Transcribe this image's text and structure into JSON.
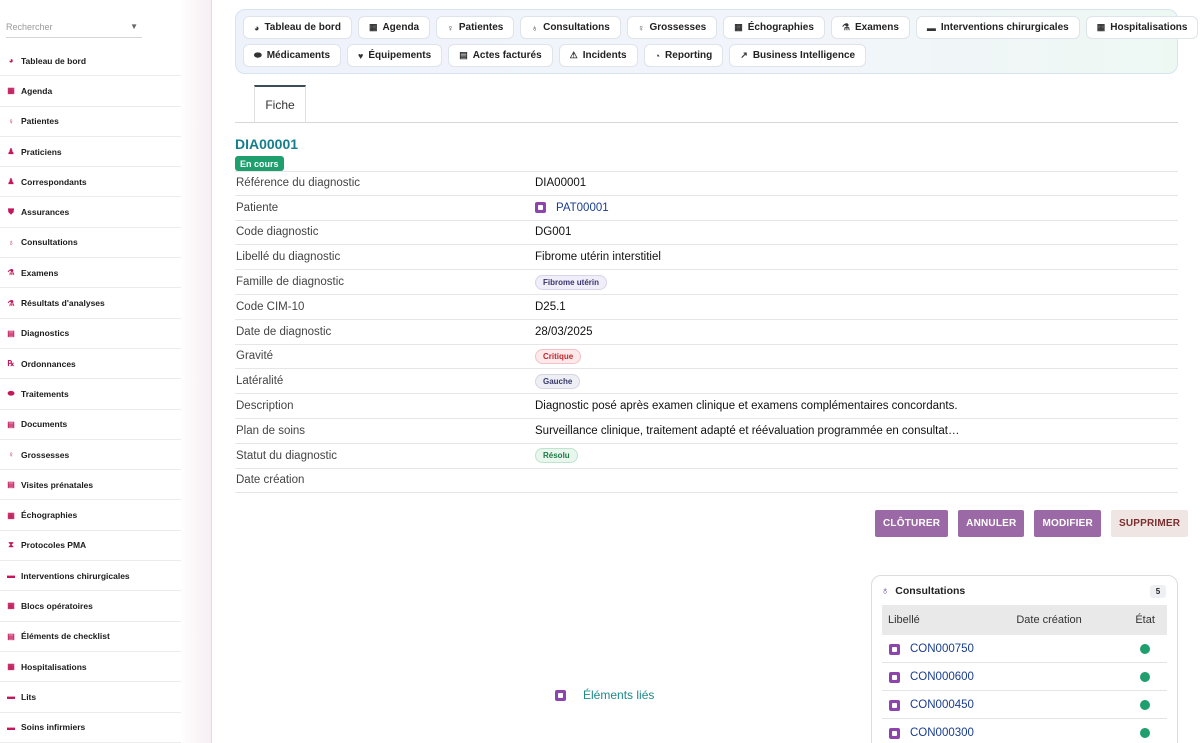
{
  "sidebar": {
    "search_placeholder": "Rechercher",
    "items": [
      {
        "label": "Tableau de bord",
        "icon": "dashboard-icon",
        "glyph": "◕"
      },
      {
        "label": "Agenda",
        "icon": "calendar-icon",
        "glyph": "▦"
      },
      {
        "label": "Patientes",
        "icon": "female-icon",
        "glyph": "♀"
      },
      {
        "label": "Praticiens",
        "icon": "doctor-icon",
        "glyph": "♟"
      },
      {
        "label": "Correspondants",
        "icon": "person-icon",
        "glyph": "♟"
      },
      {
        "label": "Assurances",
        "icon": "shield-icon",
        "glyph": "⛊"
      },
      {
        "label": "Consultations",
        "icon": "stethoscope-icon",
        "glyph": "♁"
      },
      {
        "label": "Examens",
        "icon": "microscope-icon",
        "glyph": "⚗"
      },
      {
        "label": "Résultats d'analyses",
        "icon": "lab-icon",
        "glyph": "⚗"
      },
      {
        "label": "Diagnostics",
        "icon": "clipboard-icon",
        "glyph": "▤"
      },
      {
        "label": "Ordonnances",
        "icon": "prescription-icon",
        "glyph": "℞"
      },
      {
        "label": "Traitements",
        "icon": "pills-icon",
        "glyph": "⬬"
      },
      {
        "label": "Documents",
        "icon": "document-icon",
        "glyph": "▤"
      },
      {
        "label": "Grossesses",
        "icon": "pregnancy-icon",
        "glyph": "♀"
      },
      {
        "label": "Visites prénatales",
        "icon": "visit-icon",
        "glyph": "▤"
      },
      {
        "label": "Échographies",
        "icon": "ultrasound-icon",
        "glyph": "▦"
      },
      {
        "label": "Protocoles PMA",
        "icon": "hourglass-icon",
        "glyph": "⧗"
      },
      {
        "label": "Interventions chirurgicales",
        "icon": "surgery-bed-icon",
        "glyph": "▬"
      },
      {
        "label": "Blocs opératoires",
        "icon": "operating-room-icon",
        "glyph": "▦"
      },
      {
        "label": "Éléments de checklist",
        "icon": "checklist-icon",
        "glyph": "▤"
      },
      {
        "label": "Hospitalisations",
        "icon": "hospital-icon",
        "glyph": "▦"
      },
      {
        "label": "Lits",
        "icon": "bed-icon",
        "glyph": "▬"
      },
      {
        "label": "Soins infirmiers",
        "icon": "nurse-icon",
        "glyph": "▬"
      }
    ]
  },
  "topnav": {
    "row1": [
      {
        "label": "Tableau de bord",
        "icon": "dashboard-icon",
        "glyph": "◕"
      },
      {
        "label": "Agenda",
        "icon": "calendar-icon",
        "glyph": "▦"
      },
      {
        "label": "Patientes",
        "icon": "female-icon",
        "glyph": "♀"
      },
      {
        "label": "Consultations",
        "icon": "stethoscope-icon",
        "glyph": "♁"
      },
      {
        "label": "Grossesses",
        "icon": "pregnancy-icon",
        "glyph": "♀"
      },
      {
        "label": "Échographies",
        "icon": "ultrasound-icon",
        "glyph": "▦"
      },
      {
        "label": "Examens",
        "icon": "microscope-icon",
        "glyph": "⚗"
      },
      {
        "label": "Interventions chirurgicales",
        "icon": "surgery-bed-icon",
        "glyph": "▬"
      },
      {
        "label": "Hospitalisations",
        "icon": "hospital-icon",
        "glyph": "▦"
      }
    ],
    "row2": [
      {
        "label": "Médicaments",
        "icon": "pills-icon",
        "glyph": "⬬"
      },
      {
        "label": "Équipements",
        "icon": "equipment-icon",
        "glyph": "♥"
      },
      {
        "label": "Actes facturés",
        "icon": "invoice-icon",
        "glyph": "▤"
      },
      {
        "label": "Incidents",
        "icon": "warning-icon",
        "glyph": "⚠"
      },
      {
        "label": "Reporting",
        "icon": "pie-chart-icon",
        "glyph": "◔"
      },
      {
        "label": "Business Intelligence",
        "icon": "line-chart-icon",
        "glyph": "↗"
      }
    ]
  },
  "tab": {
    "label": "Fiche"
  },
  "record": {
    "ref": "DIA00001",
    "status": "En cours",
    "fields": [
      {
        "label": "Référence du diagnostic",
        "value": "DIA00001",
        "kind": "text"
      },
      {
        "label": "Patiente",
        "value": "PAT00001",
        "kind": "link"
      },
      {
        "label": "Code diagnostic",
        "value": "DG001",
        "kind": "text"
      },
      {
        "label": "Libellé du diagnostic",
        "value": "Fibrome utérin interstitiel",
        "kind": "text"
      },
      {
        "label": "Famille de diagnostic",
        "value": "Fibrome utérin",
        "kind": "chip-family"
      },
      {
        "label": "Code CIM-10",
        "value": "D25.1",
        "kind": "text"
      },
      {
        "label": "Date de diagnostic",
        "value": "28/03/2025",
        "kind": "text"
      },
      {
        "label": "Gravité",
        "value": "Critique",
        "kind": "chip-crit"
      },
      {
        "label": "Latéralité",
        "value": "Gauche",
        "kind": "chip-lat"
      },
      {
        "label": "Description",
        "value": "Diagnostic posé après examen clinique et examens complémentaires concordants.",
        "kind": "text"
      },
      {
        "label": "Plan de soins",
        "value": "Surveillance clinique, traitement adapté et réévaluation programmée en consultat…",
        "kind": "text"
      },
      {
        "label": "Statut du diagnostic",
        "value": "Résolu",
        "kind": "chip-res"
      },
      {
        "label": "Date création",
        "value": "",
        "kind": "text"
      }
    ]
  },
  "actions": {
    "close": "CLÔTURER",
    "cancel": "ANNULER",
    "edit": "MODIFIER",
    "delete": "SUPPRIMER"
  },
  "linked": {
    "label": "Éléments liés"
  },
  "consultations": {
    "title": "Consultations",
    "count": "5",
    "columns": [
      "Libellé",
      "Date création",
      "État"
    ],
    "rows": [
      {
        "label": "CON000750",
        "date": ""
      },
      {
        "label": "CON000600",
        "date": ""
      },
      {
        "label": "CON000450",
        "date": ""
      },
      {
        "label": "CON000300",
        "date": ""
      }
    ]
  },
  "colors": {
    "accent_teal": "#167d8c",
    "status_green": "#1f9e6e",
    "action_purple": "#9b6aa6",
    "critical_red": "#c0282f"
  }
}
